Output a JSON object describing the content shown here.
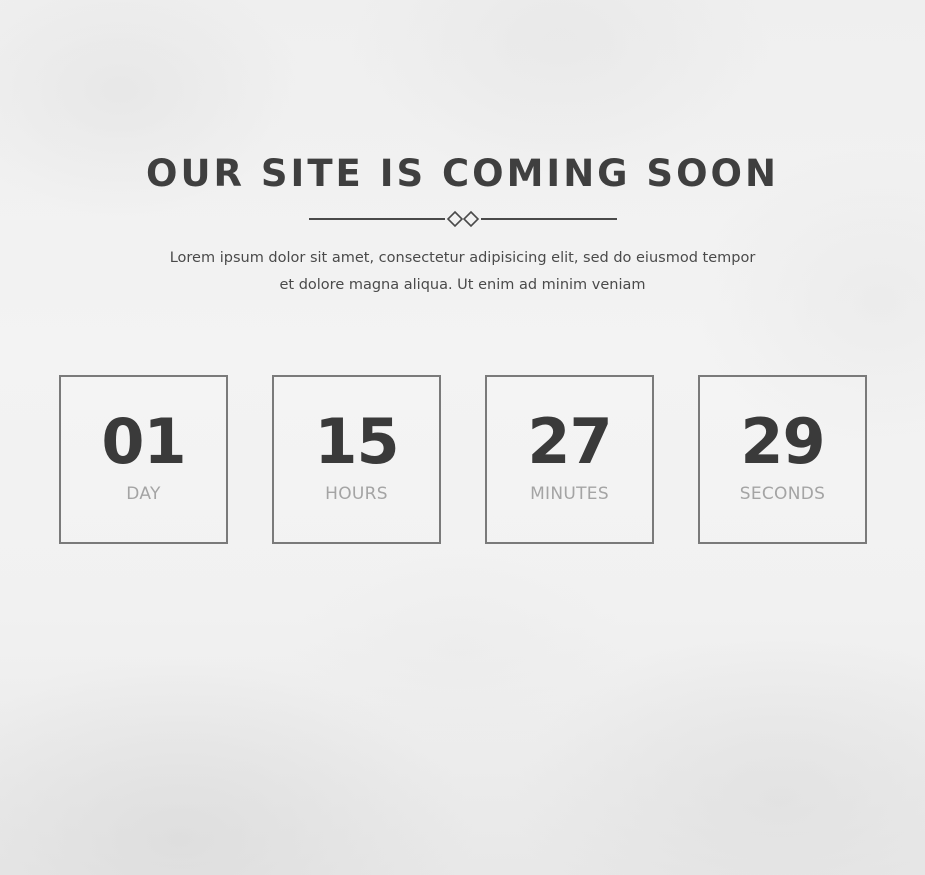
{
  "hero": {
    "title": "OUR SITE IS COMING SOON",
    "description_line1": "Lorem ipsum dolor sit amet, consectetur adipisicing elit, sed do eiusmod tempor",
    "description_line2": "et dolore magna aliqua. Ut enim ad minim veniam"
  },
  "countdown": [
    {
      "value": "01",
      "label": "DAY"
    },
    {
      "value": "15",
      "label": "HOURS"
    },
    {
      "value": "27",
      "label": "MINUTES"
    },
    {
      "value": "29",
      "label": "SECONDS"
    }
  ],
  "colors": {
    "heading": "#3f3f3f",
    "value": "#3a3a3a",
    "label": "#a4a4a4",
    "box_border": "#7a7a7a",
    "background": "#f0f0f0"
  },
  "icons": {
    "divider": "double-diamond-divider-icon"
  }
}
